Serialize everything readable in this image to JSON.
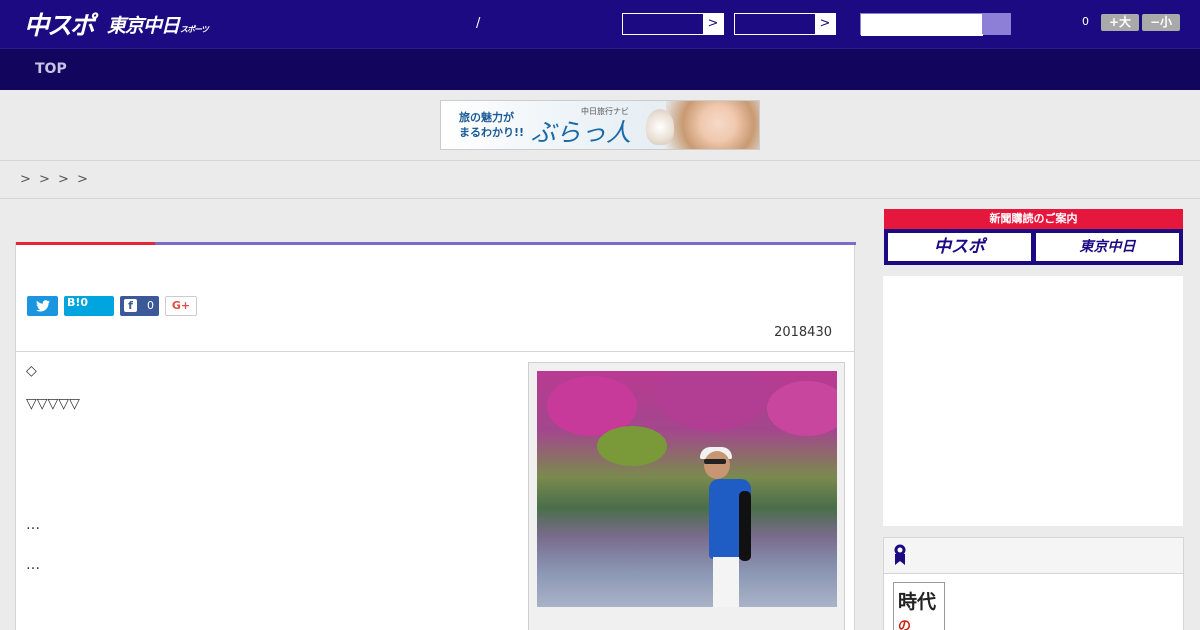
{
  "header": {
    "logo_main": "中スポ",
    "logo_sub": "東京中日",
    "logo_sub_small": "スポーツ",
    "slash": "/",
    "select1_arrow": ">",
    "select2_arrow": ">",
    "counter": "0",
    "font_up_label": "+大",
    "font_down_label": "−小"
  },
  "nav": {
    "top_label": "TOP"
  },
  "banner": {
    "line1": "旅の魅力が",
    "line2": "まるわかり!!",
    "small": "中日旅行ナビ",
    "brand": "ぶらっ人"
  },
  "breadcrumb": [
    ">",
    ">",
    ">",
    ">"
  ],
  "article": {
    "share_twitter_icon": "twitter-icon",
    "share_hatena_label": "B!0",
    "share_fb_icon": "f",
    "share_fb_count": "0",
    "share_gplus_label": "G+",
    "date": "2018430",
    "lines": [
      "◇",
      "▽▽▽▽▽",
      "…",
      "…"
    ]
  },
  "sidebar": {
    "subscribe_header": "新聞購読のご案内",
    "subscribe_btn1": "中スポ",
    "subscribe_btn2": "東京中日",
    "box_thumb_line1": "時",
    "box_thumb_mid": "代",
    "box_thumb_accent": "の"
  },
  "colors": {
    "header_bg": "#1c0a82",
    "nav_bg": "#12055e",
    "accent_red": "#e52835",
    "accent_purple": "#7b6cc9"
  }
}
